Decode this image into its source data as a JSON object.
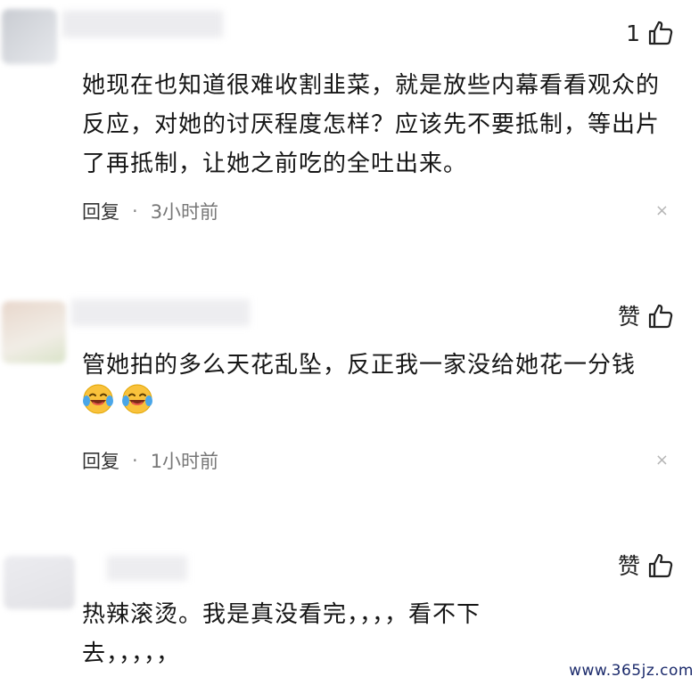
{
  "comments": [
    {
      "like_label": "1",
      "text": "她现在也知道很难收割韭菜，就是放些内幕看看观众的反应，对她的讨厌程度怎样？应该先不要抵制，等出片了再抵制，让她之前吃的全吐出来。",
      "reply_label": "回复",
      "separator": "·",
      "time": "3小时前",
      "close_label": "×"
    },
    {
      "like_label": "赞",
      "text": "管她拍的多么天花乱坠，反正我一家没给她花一分钱",
      "emojis": [
        "laughing-crying-emoji",
        "laughing-crying-emoji"
      ],
      "reply_label": "回复",
      "separator": "·",
      "time": "1小时前",
      "close_label": "×"
    },
    {
      "like_label": "赞",
      "text": "热辣滚烫。我是真没看完，，，，看不下去，，，，，"
    }
  ],
  "watermark": "www.365jz.com",
  "colors": {
    "text": "#161616",
    "meta": "#777777",
    "close": "#b5b5b5",
    "watermark": "#1b2a6b"
  }
}
